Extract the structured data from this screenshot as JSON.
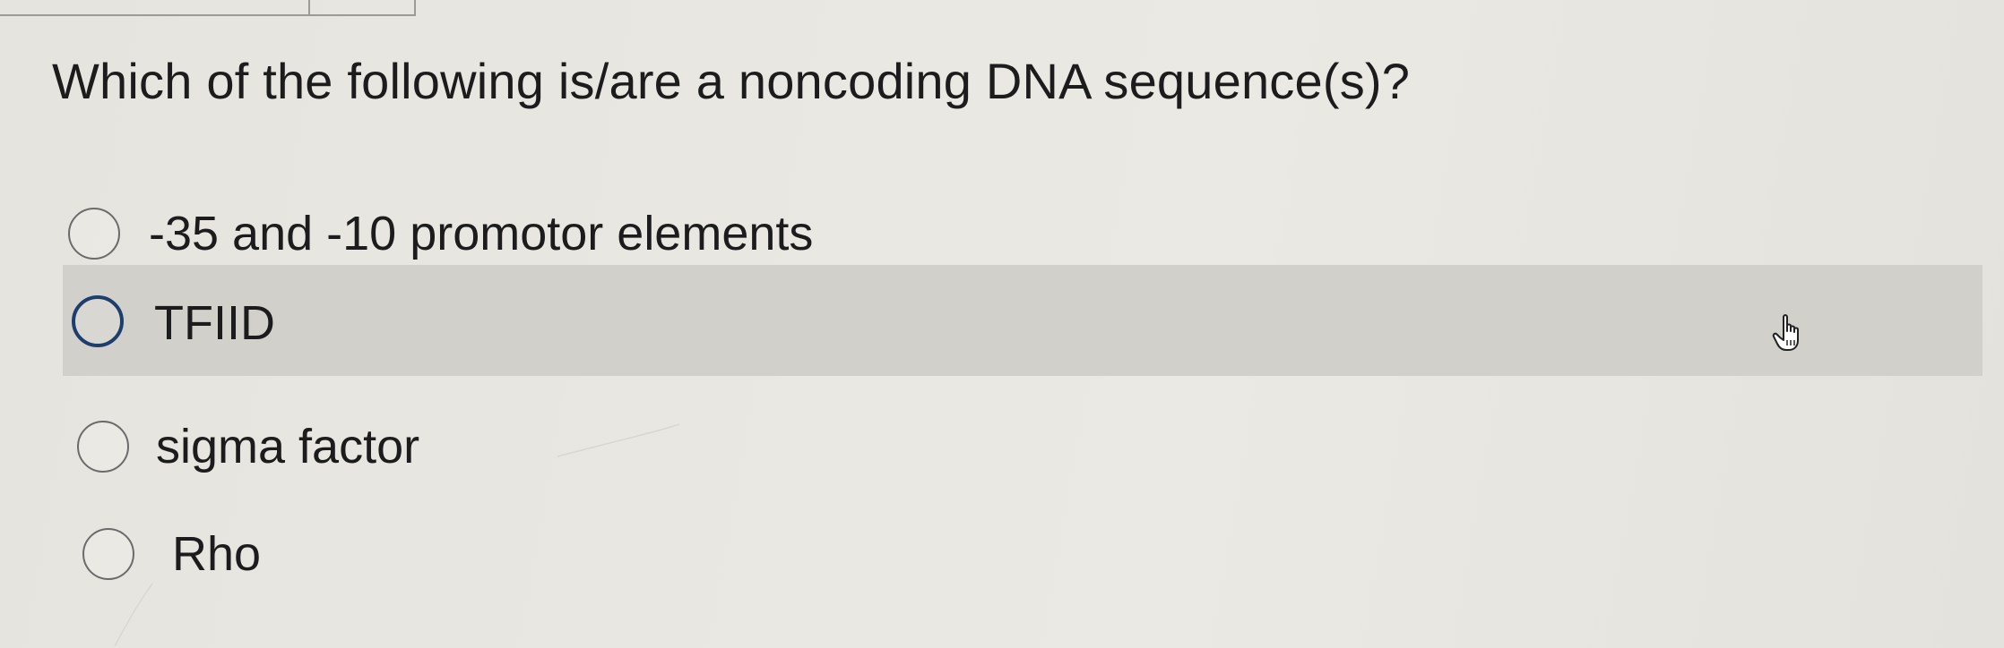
{
  "question": {
    "text": "Which of the following is/are a noncoding DNA sequence(s)?"
  },
  "options": [
    {
      "label": "-35 and -10 promotor elements",
      "state": "unselected"
    },
    {
      "label": "TFIID",
      "state": "hovered-focused"
    },
    {
      "label": "sigma factor",
      "state": "unselected"
    },
    {
      "label": "Rho",
      "state": "unselected"
    }
  ],
  "cursor": {
    "icon": "hand-pointer-icon"
  },
  "colors": {
    "background": "#e9e7e1",
    "hover_row": "#d2d0cb",
    "focus_ring": "#1e3e6e",
    "radio_border": "#6b6b6b",
    "text": "#1c1c1c"
  }
}
